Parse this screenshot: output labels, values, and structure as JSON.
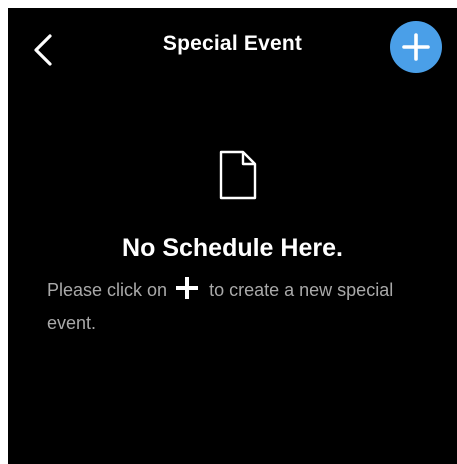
{
  "header": {
    "title": "Special Event",
    "back_icon": "chevron-left-icon",
    "add_icon": "plus-icon"
  },
  "empty_state": {
    "icon": "document-icon",
    "title": "No Schedule Here.",
    "message_before": "Please click on",
    "message_icon": "plus-icon",
    "message_after": "to create a new special event."
  },
  "colors": {
    "background": "#000000",
    "accent": "#4a9fe8",
    "title_text": "#ffffff",
    "message_text": "#a9a9a9"
  }
}
